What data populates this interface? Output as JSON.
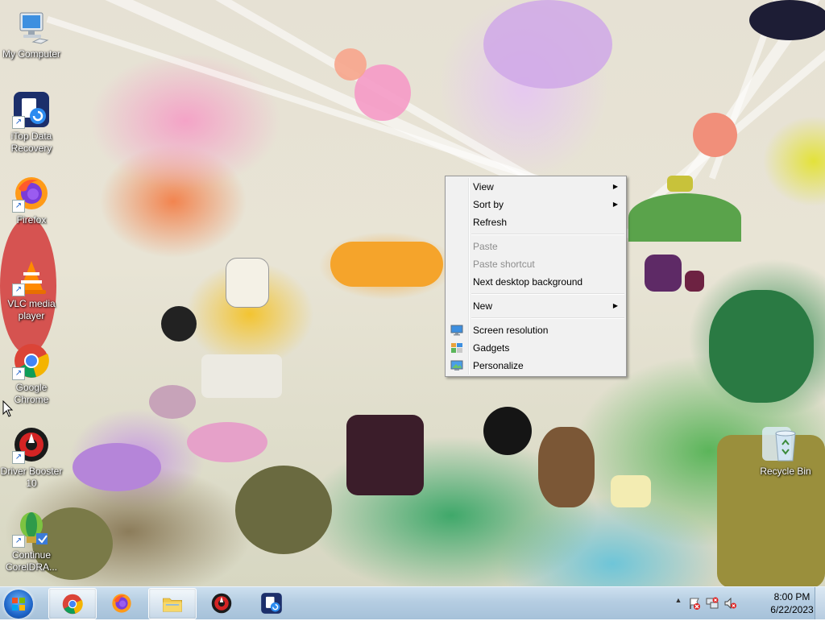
{
  "desktop_icons": [
    {
      "label": "My Computer",
      "icon": "computer-icon"
    },
    {
      "label": "iTop Data Recovery",
      "icon": "itop-data-recovery-icon"
    },
    {
      "label": "Firefox",
      "icon": "firefox-icon"
    },
    {
      "label": "VLC media player",
      "icon": "vlc-icon"
    },
    {
      "label": "Google Chrome",
      "icon": "chrome-icon"
    },
    {
      "label": "Driver Booster 10",
      "icon": "driver-booster-icon"
    },
    {
      "label": "Continue CorelDRA...",
      "icon": "coreldraw-icon"
    },
    {
      "label": "Recycle Bin",
      "icon": "recycle-bin-icon"
    }
  ],
  "context_menu": {
    "view": "View",
    "sort_by": "Sort by",
    "refresh": "Refresh",
    "paste": "Paste",
    "paste_shortcut": "Paste shortcut",
    "next_background": "Next desktop background",
    "new": "New",
    "screen_resolution": "Screen resolution",
    "gadgets": "Gadgets",
    "personalize": "Personalize",
    "submenu_arrow": "▶"
  },
  "taskbar": {
    "apps": [
      "chrome-icon",
      "firefox-icon",
      "file-explorer-icon",
      "driver-booster-icon",
      "itop-data-recovery-icon"
    ],
    "active_app": "chrome-icon"
  },
  "tray": {
    "chevron": "▲",
    "time": "8:00 PM",
    "date": "6/22/2023"
  },
  "colors": {
    "taskbar": "#b5cde2",
    "menu_bg": "#f1f1f1",
    "disabled_text": "#8d8d8d"
  }
}
